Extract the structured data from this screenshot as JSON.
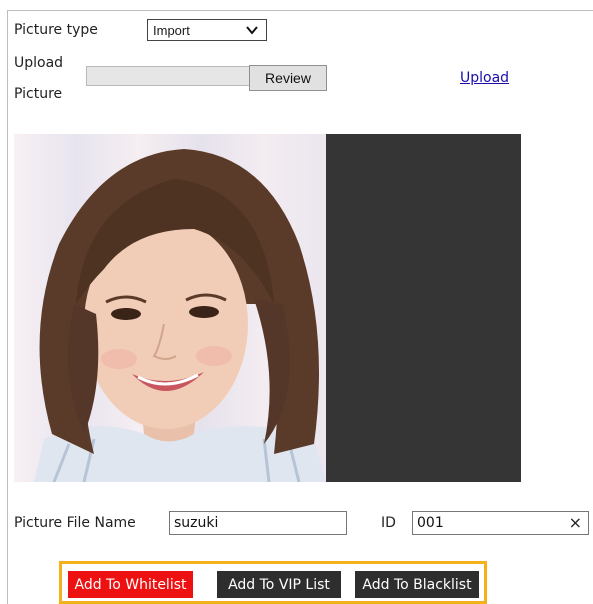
{
  "form": {
    "picture_type_label": "Picture type",
    "picture_type_value": "Import",
    "upload_label_line1": "Upload",
    "upload_label_line2": "Picture",
    "review_button": "Review",
    "upload_link": "Upload",
    "file_name_label": "Picture File Name",
    "file_name_value": "suzuki",
    "id_label": "ID",
    "id_value": "001",
    "clear_symbol": "×"
  },
  "actions": {
    "whitelist": "Add To Whitelist",
    "vip": "Add To VIP List",
    "blacklist": "Add To Blacklist"
  },
  "colors": {
    "whitelist_bg": "#ee1111",
    "dark_button_bg": "#2e2e2e",
    "group_border": "#f3b21b",
    "link": "#1a0dab",
    "preview_bg": "#353535"
  },
  "icons": {
    "select_arrow": "chevron-down-icon",
    "clear": "close-icon"
  }
}
